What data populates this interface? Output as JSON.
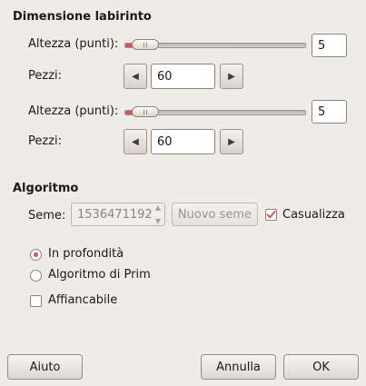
{
  "maze_size": {
    "title": "Dimensione labirinto",
    "row1": {
      "label": "Altezza (punti):",
      "value": "5",
      "slider_fraction": 0.02
    },
    "row2": {
      "label": "Pezzi:",
      "value": "60"
    },
    "row3": {
      "label": "Altezza (punti):",
      "value": "5",
      "slider_fraction": 0.02
    },
    "row4": {
      "label": "Pezzi:",
      "value": "60"
    }
  },
  "algorithm": {
    "title": "Algoritmo",
    "seed_label": "Seme:",
    "seed_value": "1536471192",
    "new_seed_button": "Nuovo seme",
    "randomize_label": "Casualizza",
    "randomize_checked": true,
    "options": [
      {
        "label": "In profondità",
        "selected": true
      },
      {
        "label": "Algoritmo di Prim",
        "selected": false
      }
    ],
    "tileable_label": "Affiancabile",
    "tileable_checked": false
  },
  "footer": {
    "help_button": "Aiuto",
    "cancel_button": "Annulla",
    "ok_button": "OK"
  },
  "icons": {
    "arrow_left": "triangle-left-icon",
    "arrow_right": "triangle-right-icon",
    "check": "checkmark-icon"
  },
  "colors": {
    "accent": "#d9534f"
  }
}
